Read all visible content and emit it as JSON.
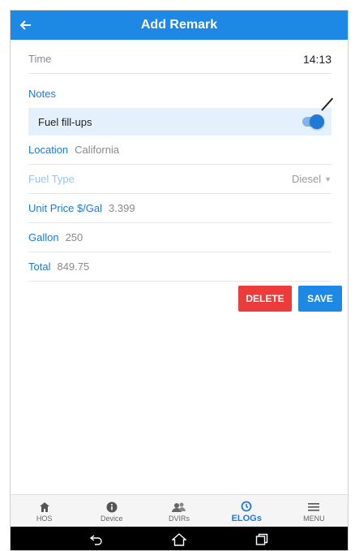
{
  "header": {
    "title": "Add Remark",
    "back_icon": "arrow-left-icon"
  },
  "form": {
    "time_label": "Time",
    "time_value": "14:13",
    "notes_label": "Notes",
    "fuel_fillups_label": "Fuel fill-ups",
    "fuel_fillups_on": true,
    "location_label": "Location",
    "location_value": "California",
    "fuel_type_label": "Fuel Type",
    "fuel_type_value": "Diesel",
    "unit_price_label": "Unit Price $/Gal",
    "unit_price_value": "3.399",
    "gallon_label": "Gallon",
    "gallon_value": "250",
    "total_label": "Total",
    "total_value": "849.75"
  },
  "actions": {
    "delete_label": "DELETE",
    "save_label": "SAVE"
  },
  "bottom_nav": [
    {
      "label": "HOS",
      "icon": "home-icon"
    },
    {
      "label": "Device",
      "icon": "info-icon"
    },
    {
      "label": "DVIRs",
      "icon": "users-icon"
    },
    {
      "label": "ELOGs",
      "icon": "clock-icon",
      "active": true
    },
    {
      "label": "MENU",
      "icon": "hamburger-icon"
    }
  ],
  "colors": {
    "primary": "#1e88e5",
    "delete": "#ec3b3b",
    "toggle_bg": "#e4f0fb"
  }
}
